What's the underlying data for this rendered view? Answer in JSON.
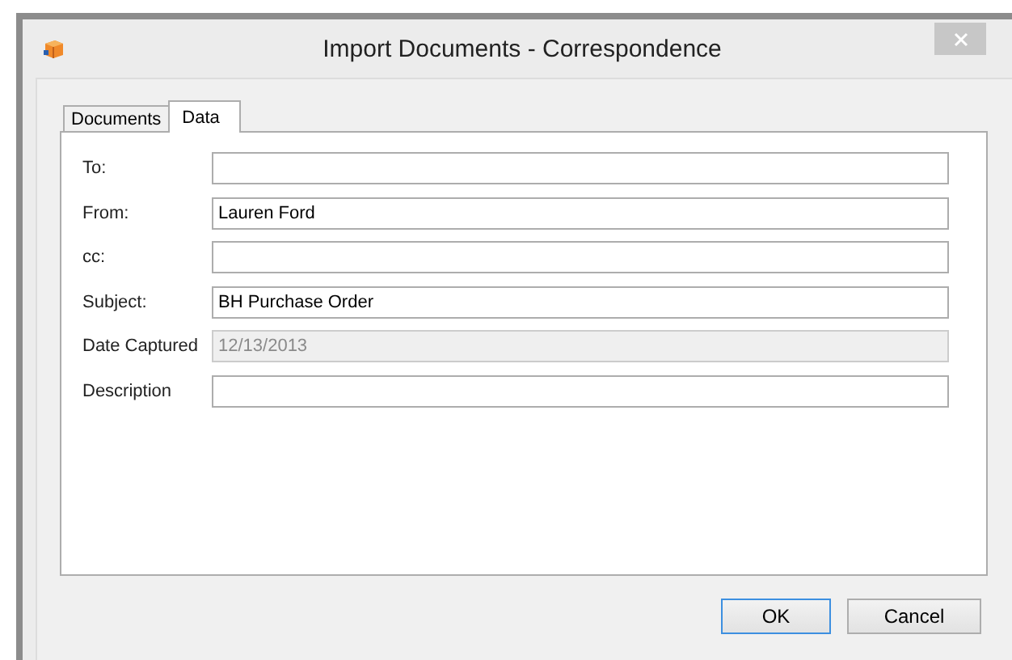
{
  "window": {
    "title": "Import Documents - Correspondence"
  },
  "tabs": [
    {
      "label": "Documents",
      "selected": false
    },
    {
      "label": "Data",
      "selected": true
    }
  ],
  "fields": [
    {
      "label": "To:",
      "disabled": false
    },
    {
      "label": "From:",
      "value": "Lauren Ford",
      "disabled": false
    },
    {
      "label": "cc:",
      "disabled": false
    },
    {
      "label": "Subject:",
      "value": "BH Purchase Order",
      "disabled": false
    },
    {
      "label": "Date Captured",
      "value": "12/13/2013",
      "disabled": true
    },
    {
      "label": "Description",
      "disabled": false
    }
  ],
  "buttons": [
    {
      "label": "OK",
      "default": true
    },
    {
      "label": "Cancel",
      "default": false
    }
  ]
}
